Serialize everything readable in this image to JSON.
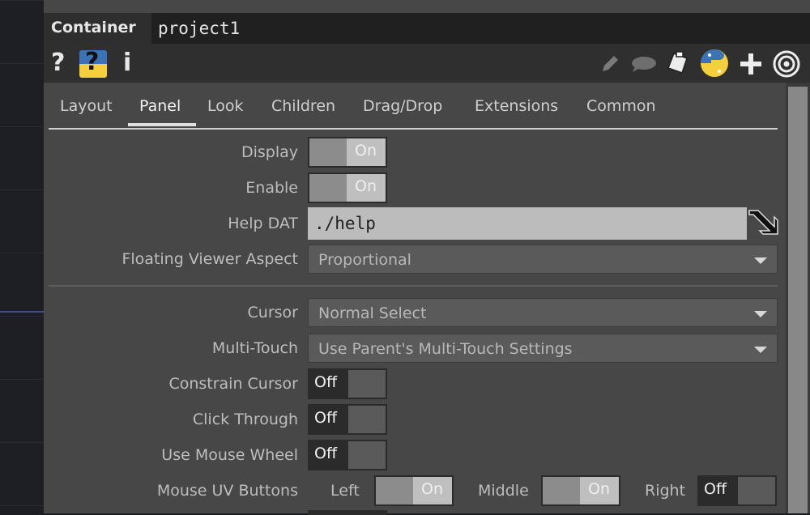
{
  "header": {
    "type": "Container",
    "name": "project1"
  },
  "icons": {
    "help": "?",
    "help_active": "?",
    "info": "i",
    "python_color_blue": "#3b74b6",
    "python_color_yellow": "#f5cf3c"
  },
  "tabs": [
    "Layout",
    "Panel",
    "Look",
    "Children",
    "Drag/Drop",
    "Extensions",
    "Common"
  ],
  "active_tab": "Panel",
  "params": {
    "display": {
      "label": "Display",
      "value": "On"
    },
    "enable": {
      "label": "Enable",
      "value": "On"
    },
    "help_dat": {
      "label": "Help DAT",
      "value": "./help"
    },
    "floating_viewer_aspect": {
      "label": "Floating Viewer Aspect",
      "value": "Proportional"
    },
    "cursor": {
      "label": "Cursor",
      "value": "Normal Select"
    },
    "multi_touch": {
      "label": "Multi-Touch",
      "value": "Use Parent's Multi-Touch Settings"
    },
    "constrain_cursor": {
      "label": "Constrain Cursor",
      "value": "Off"
    },
    "click_through": {
      "label": "Click Through",
      "value": "Off"
    },
    "use_mouse_wheel": {
      "label": "Use Mouse Wheel",
      "value": "Off"
    },
    "mouse_uv_buttons": {
      "label": "Mouse UV Buttons",
      "left_label": "Left",
      "left_value": "On",
      "middle_label": "Middle",
      "middle_value": "On",
      "right_label": "Right",
      "right_value": "Off"
    }
  }
}
